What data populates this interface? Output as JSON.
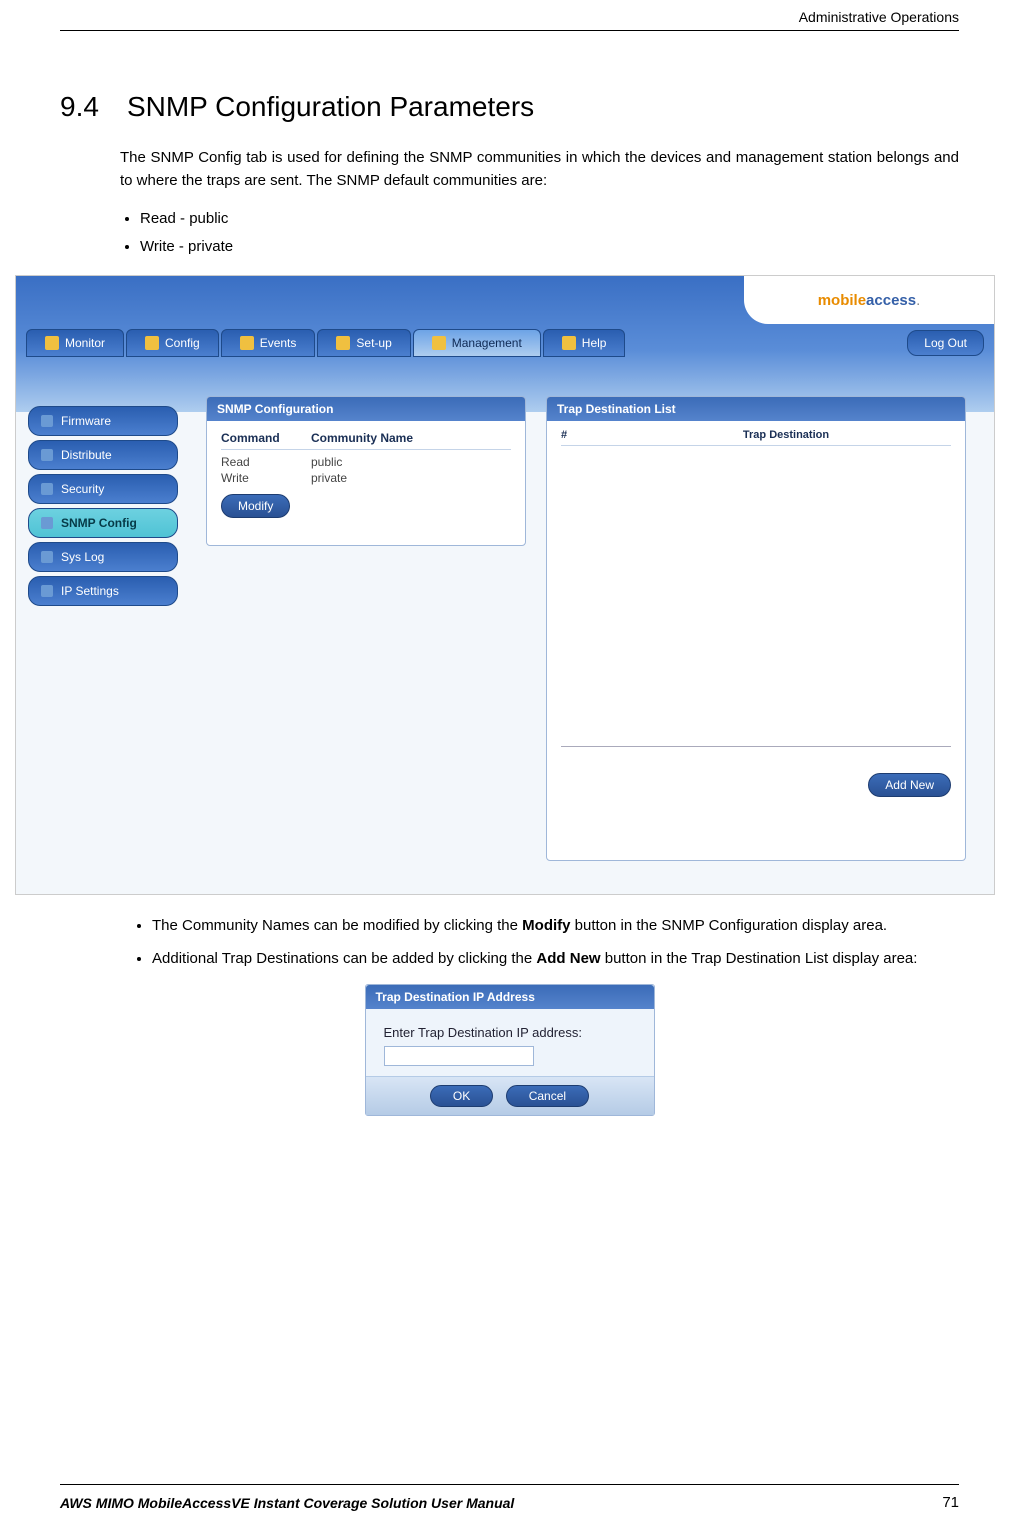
{
  "doc": {
    "header_right": "Administrative Operations",
    "section_number": "9.4",
    "section_title": "SNMP Configuration Parameters",
    "intro": "The SNMP Config tab is used for defining the SNMP communities in which the devices and management station belongs and to where the traps are sent. The SNMP default communities are:",
    "bullets_top": [
      "Read - public",
      "Write - private"
    ],
    "bullets_bottom": [
      {
        "pre": "The Community Names can be modified by clicking the ",
        "bold": "Modify",
        "post": " button in the SNMP Configuration display area."
      },
      {
        "pre": "Additional Trap Destinations can be added by clicking the ",
        "bold": "Add New",
        "post": " button in the Trap Destination List display area:"
      }
    ],
    "footer_left": "AWS MIMO MobileAccessVE Instant Coverage Solution User Manual",
    "footer_right": "71"
  },
  "app": {
    "logo_a": "mobile",
    "logo_b": "access",
    "logo_dot": ".",
    "nav": [
      "Monitor",
      "Config",
      "Events",
      "Set-up",
      "Management",
      "Help"
    ],
    "logout": "Log Out",
    "sidebar": [
      "Firmware",
      "Distribute",
      "Security",
      "SNMP Config",
      "Sys Log",
      "IP Settings"
    ],
    "snmp_panel_title": "SNMP Configuration",
    "snmp_headers": [
      "Command",
      "Community Name"
    ],
    "snmp_rows": [
      {
        "cmd": "Read",
        "name": "public"
      },
      {
        "cmd": "Write",
        "name": "private"
      }
    ],
    "modify_btn": "Modify",
    "trap_panel_title": "Trap Destination List",
    "trap_headers": [
      "#",
      "Trap Destination"
    ],
    "add_new_btn": "Add New"
  },
  "dialog": {
    "title": "Trap Destination IP Address",
    "label": "Enter Trap Destination IP address:",
    "ok": "OK",
    "cancel": "Cancel"
  }
}
